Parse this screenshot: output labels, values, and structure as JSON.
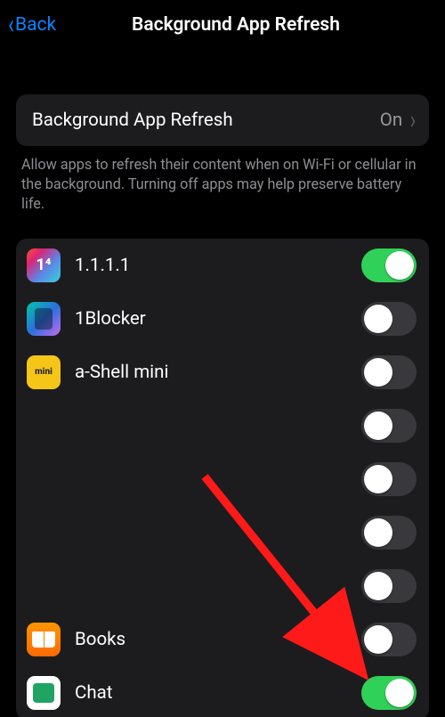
{
  "nav": {
    "back_label": "Back",
    "title": "Background App Refresh"
  },
  "master": {
    "label": "Background App Refresh",
    "value": "On"
  },
  "footer": "Allow apps to refresh their content when on Wi-Fi or cellular in the background. Turning off apps may help preserve battery life.",
  "apps": [
    {
      "name": "1.1.1.1",
      "on": true,
      "icon": "icon-1111"
    },
    {
      "name": "1Blocker",
      "on": false,
      "icon": "icon-1blocker"
    },
    {
      "name": "a-Shell mini",
      "on": false,
      "icon": "icon-ashell"
    },
    {
      "name": "",
      "on": false,
      "icon": ""
    },
    {
      "name": "",
      "on": false,
      "icon": ""
    },
    {
      "name": "",
      "on": false,
      "icon": ""
    },
    {
      "name": "",
      "on": false,
      "icon": ""
    },
    {
      "name": "Books",
      "on": false,
      "icon": "icon-books"
    },
    {
      "name": "Chat",
      "on": true,
      "icon": "icon-chat"
    }
  ]
}
